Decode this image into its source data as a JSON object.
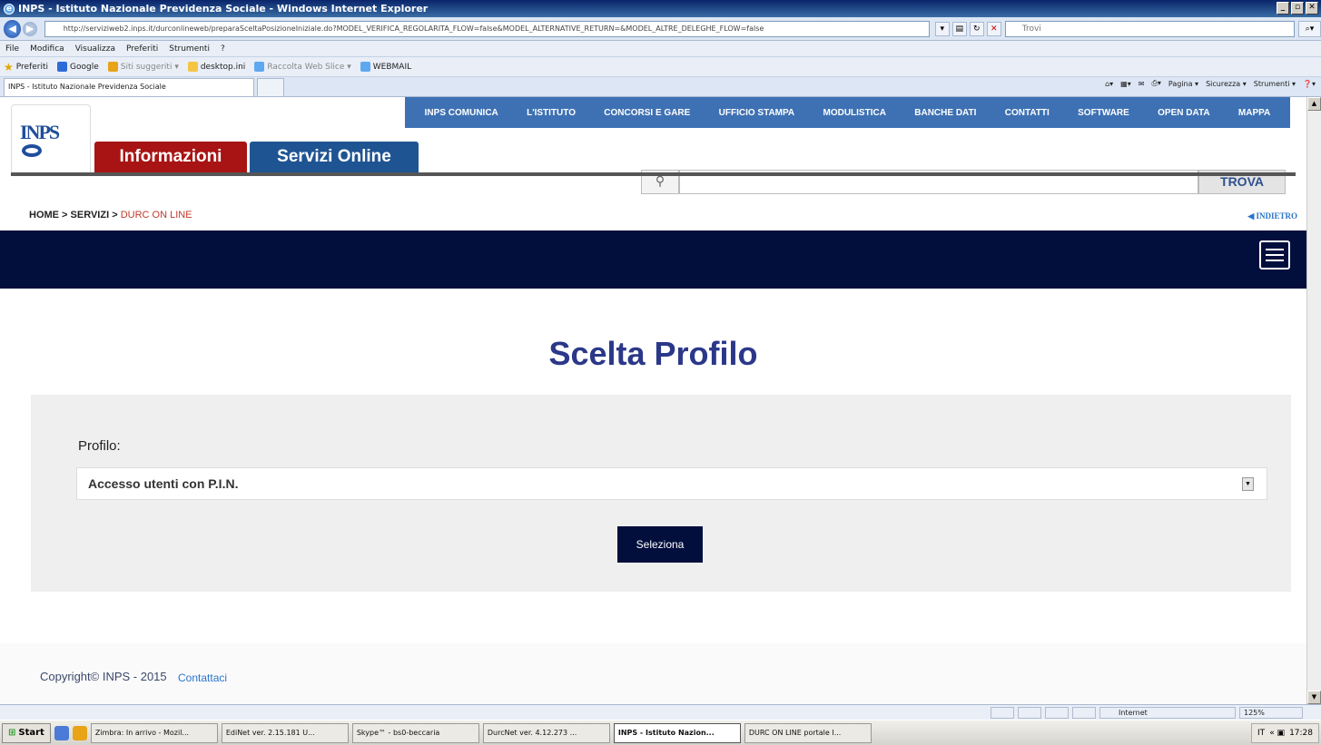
{
  "window": {
    "title": "INPS - Istituto Nazionale Previdenza Sociale - Windows Internet Explorer",
    "address": "http://serviziweb2.inps.it/durconlineweb/preparaSceltaPosizioneIniziale.do?MODEL_VERIFICA_REGOLARITA_FLOW=false&MODEL_ALTERNATIVE_RETURN=&MODEL_ALTRE_DELEGHE_FLOW=false",
    "search_placeholder": "Trovi"
  },
  "menu": [
    "File",
    "Modifica",
    "Visualizza",
    "Preferiti",
    "Strumenti",
    "?"
  ],
  "favorites": {
    "preferiti": "Preferiti",
    "items": [
      {
        "label": "Google",
        "muted": false
      },
      {
        "label": "Siti suggeriti ▾",
        "muted": true
      },
      {
        "label": "desktop.ini",
        "muted": false
      },
      {
        "label": "Raccolta Web Slice ▾",
        "muted": true
      },
      {
        "label": "WEBMAIL",
        "muted": false
      }
    ]
  },
  "tab": {
    "label": "INPS - Istituto Nazionale Previdenza Sociale"
  },
  "commandbar": [
    "Pagina ▾",
    "Sicurezza ▾",
    "Strumenti ▾"
  ],
  "site": {
    "topnav": [
      "INPS COMUNICA",
      "L'ISTITUTO",
      "CONCORSI E GARE",
      "UFFICIO STAMPA",
      "MODULISTICA",
      "BANCHE DATI",
      "CONTATTI",
      "SOFTWARE",
      "OPEN DATA",
      "MAPPA"
    ],
    "logo_text": "INPS",
    "tab_info": "Informazioni",
    "tab_servizi": "Servizi Online",
    "trova": "TROVA",
    "breadcrumb": {
      "home": "HOME >",
      "servizi": "SERVIZI >",
      "current": "DURC ON LINE"
    },
    "indietro": "◀ INDIETRO",
    "page_title": "Scelta Profilo",
    "form": {
      "label": "Profilo:",
      "selected": "Accesso utenti con P.I.N.",
      "button": "Seleziona"
    },
    "footer": {
      "copyright": "Copyright© INPS - 2015",
      "contact": "Contattaci"
    }
  },
  "statusbar": {
    "zone": "Internet",
    "zoom": "125%"
  },
  "taskbar": {
    "start": "Start",
    "tasks": [
      {
        "label": "Zimbra: In arrivo - Mozil...",
        "active": false
      },
      {
        "label": "EdiNet ver. 2.15.181 U...",
        "active": false
      },
      {
        "label": "Skype™ - bs0-beccaria",
        "active": false
      },
      {
        "label": "DurcNet ver. 4.12.273 ...",
        "active": false
      },
      {
        "label": "INPS - Istituto Nazion...",
        "active": true
      },
      {
        "label": "DURC ON LINE portale I...",
        "active": false
      }
    ],
    "clock": "17:28"
  }
}
